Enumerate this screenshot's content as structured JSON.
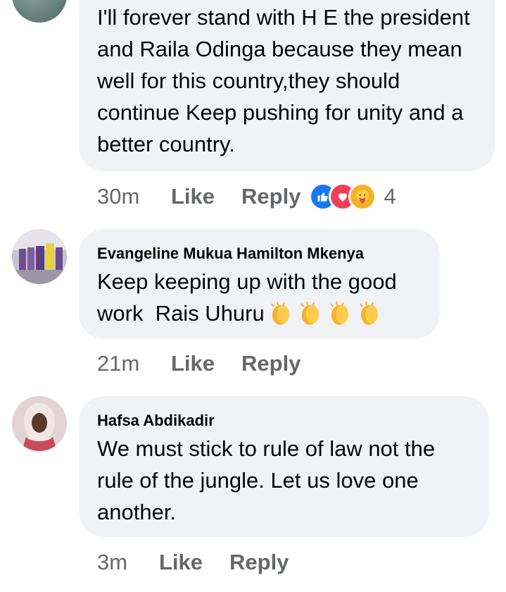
{
  "comments": [
    {
      "author": "",
      "text": "I'll forever stand with H E the president and Raila Odinga because they mean well for this country,they should continue Keep pushing for unity and a better country.",
      "time": "30m",
      "like_label": "Like",
      "reply_label": "Reply",
      "reaction_count": "4",
      "reactions": [
        "like-icon",
        "love-icon",
        "care-icon"
      ]
    },
    {
      "author": "Evangeline Mukua Hamilton Mkenya",
      "text": "Keep keeping up with the good work  Rais Uhuru",
      "emoji": [
        "clapping-hands-icon",
        "clapping-hands-icon",
        "clapping-hands-icon",
        "clapping-hands-icon"
      ],
      "time": "21m",
      "like_label": "Like",
      "reply_label": "Reply"
    },
    {
      "author": "Hafsa Abdikadir",
      "text": "We must stick to rule of law not the rule of the jungle. Let us love one another.",
      "time": "3m",
      "like_label": "Like",
      "reply_label": "Reply"
    }
  ],
  "colors": {
    "bubble": "#f0f2f5",
    "meta": "#65676b",
    "like_blue": "#1877f2",
    "love_red": "#f33e58",
    "care_yellow": "#f7b125"
  }
}
